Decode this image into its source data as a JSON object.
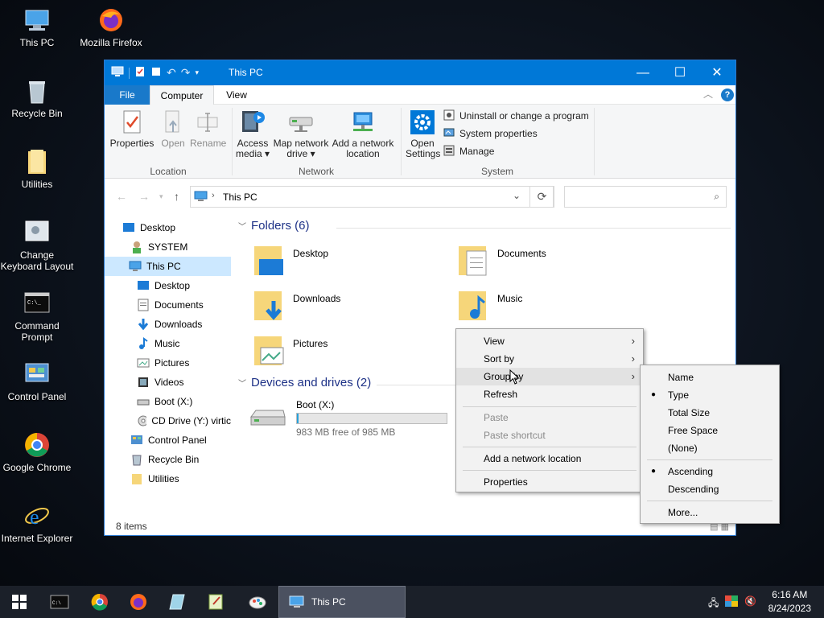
{
  "desktop": {
    "icons": [
      {
        "label": "This PC"
      },
      {
        "label": "Mozilla Firefox"
      },
      {
        "label": "Recycle Bin"
      },
      {
        "label": "Utilities"
      },
      {
        "label": "Change Keyboard Layout"
      },
      {
        "label": "Command Prompt"
      },
      {
        "label": "Control Panel"
      },
      {
        "label": "Google Chrome"
      },
      {
        "label": "Internet Explorer"
      }
    ]
  },
  "window": {
    "title": "This PC",
    "tabs": {
      "file": "File",
      "computer": "Computer",
      "view": "View"
    },
    "ribbon": {
      "location": {
        "label": "Location",
        "properties": "Properties",
        "open": "Open",
        "rename": "Rename"
      },
      "network": {
        "label": "Network",
        "access_media_1": "Access",
        "access_media_2": "media ▾",
        "map_drive_1": "Map network",
        "map_drive_2": "drive ▾",
        "add_location_1": "Add a network",
        "add_location_2": "location"
      },
      "system": {
        "label": "System",
        "open_settings_1": "Open",
        "open_settings_2": "Settings",
        "uninstall": "Uninstall or change a program",
        "system_properties": "System properties",
        "manage": "Manage"
      }
    },
    "address": {
      "path": "This PC",
      "search_placeholder": ""
    },
    "tree": [
      {
        "label": "Desktop"
      },
      {
        "label": "SYSTEM"
      },
      {
        "label": "This PC"
      },
      {
        "label": "Desktop"
      },
      {
        "label": "Documents"
      },
      {
        "label": "Downloads"
      },
      {
        "label": "Music"
      },
      {
        "label": "Pictures"
      },
      {
        "label": "Videos"
      },
      {
        "label": "Boot (X:)"
      },
      {
        "label": "CD Drive (Y:) virtic"
      },
      {
        "label": "Control Panel"
      },
      {
        "label": "Recycle Bin"
      },
      {
        "label": "Utilities"
      }
    ],
    "content": {
      "folders_header": "Folders (6)",
      "folders": [
        {
          "label": "Desktop"
        },
        {
          "label": "Documents"
        },
        {
          "label": "Downloads"
        },
        {
          "label": "Music"
        },
        {
          "label": "Pictures"
        }
      ],
      "drives_header": "Devices and drives (2)",
      "drive": {
        "label": "Boot (X:)",
        "free_text": "983 MB free of 985 MB",
        "used_fraction": 0.002
      }
    },
    "status": {
      "items": "8 items"
    }
  },
  "context_menu": {
    "items": [
      {
        "label": "View"
      },
      {
        "label": "Sort by"
      },
      {
        "label": "Group by"
      },
      {
        "label": "Refresh"
      },
      {
        "label": "Paste"
      },
      {
        "label": "Paste shortcut"
      },
      {
        "label": "Add a network location"
      },
      {
        "label": "Properties"
      }
    ]
  },
  "submenu": {
    "items": [
      {
        "label": "Name"
      },
      {
        "label": "Type",
        "checked": true
      },
      {
        "label": "Total Size"
      },
      {
        "label": "Free Space"
      },
      {
        "label": "(None)"
      },
      {
        "label": "Ascending",
        "checked": true
      },
      {
        "label": "Descending"
      },
      {
        "label": "More..."
      }
    ]
  },
  "taskbar": {
    "active_window": "This PC",
    "time": "6:16 AM",
    "date": "8/24/2023"
  },
  "colors": {
    "accent": "#0078d7",
    "taskbar": "#1b2029",
    "selection": "#cce8ff",
    "group_header": "#1e3287"
  }
}
